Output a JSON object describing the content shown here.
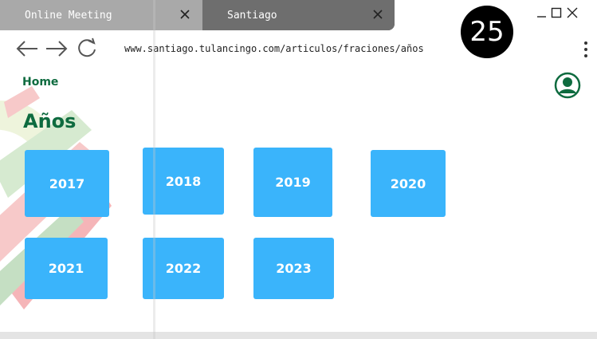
{
  "tabs": [
    {
      "title": "Online Meeting",
      "active": false
    },
    {
      "title": "Santiago",
      "active": true
    }
  ],
  "badge": {
    "count": "25"
  },
  "toolbar": {
    "back_icon": "arrow-left-icon",
    "forward_icon": "arrow-right-icon",
    "reload_icon": "reload-icon",
    "url": "www.santiago.tulancingo.com/articulos/fraciones/años",
    "menu_icon": "more-vertical-icon"
  },
  "window_controls": [
    "minimize-icon",
    "maximize-icon",
    "close-icon"
  ],
  "page": {
    "nav": {
      "home_label": "Home",
      "user_icon": "user-circle-icon"
    },
    "title": "Años",
    "years": [
      "2017",
      "2018",
      "2019",
      "2020",
      "2021",
      "2022",
      "2023"
    ]
  },
  "colors": {
    "accent_green": "#0e6b3f",
    "card_blue": "#3ab4fb",
    "tab_active": "#6e6e6e",
    "tab_inactive": "#a9a9a9"
  }
}
